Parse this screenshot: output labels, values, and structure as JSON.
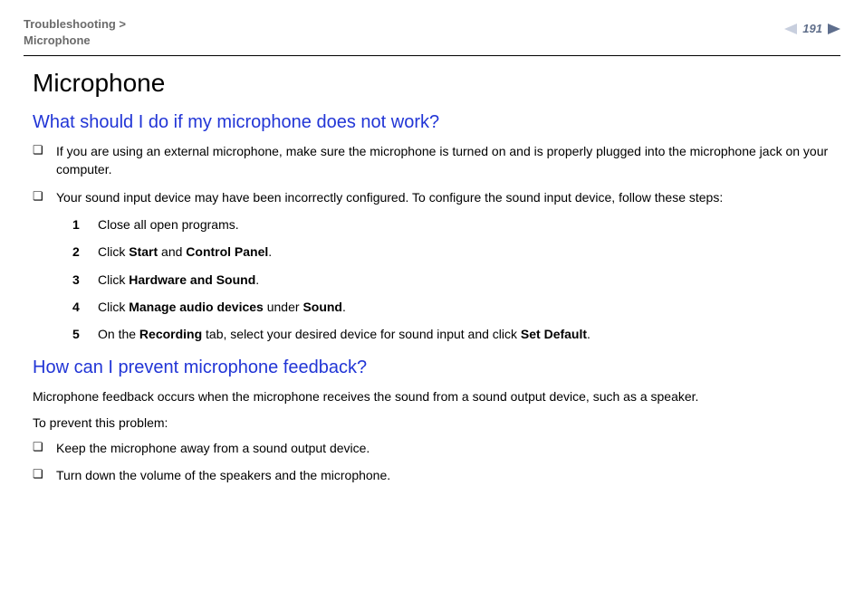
{
  "header": {
    "breadcrumb_line1": "Troubleshooting >",
    "breadcrumb_line2": "Microphone",
    "page_number": "191"
  },
  "title": "Microphone",
  "section1": {
    "heading": "What should I do if my microphone does not work?",
    "bullets": [
      "If you are using an external microphone, make sure the microphone is turned on and is properly plugged into the microphone jack on your computer.",
      "Your sound input device may have been incorrectly configured. To configure the sound input device, follow these steps:"
    ],
    "steps": [
      {
        "num": "1",
        "pre": "Close all open programs."
      },
      {
        "num": "2",
        "pre": "Click ",
        "b1": "Start",
        "mid1": " and ",
        "b2": "Control Panel",
        "post": "."
      },
      {
        "num": "3",
        "pre": "Click ",
        "b1": "Hardware and Sound",
        "post": "."
      },
      {
        "num": "4",
        "pre": "Click ",
        "b1": "Manage audio devices",
        "mid1": " under ",
        "b2": "Sound",
        "post": "."
      },
      {
        "num": "5",
        "pre": "On the ",
        "b1": "Recording",
        "mid1": " tab, select your desired device for sound input and click ",
        "b2": "Set Default",
        "post": "."
      }
    ]
  },
  "section2": {
    "heading": "How can I prevent microphone feedback?",
    "para1": "Microphone feedback occurs when the microphone receives the sound from a sound output device, such as a speaker.",
    "para2": "To prevent this problem:",
    "bullets": [
      "Keep the microphone away from a sound output device.",
      "Turn down the volume of the speakers and the microphone."
    ]
  }
}
